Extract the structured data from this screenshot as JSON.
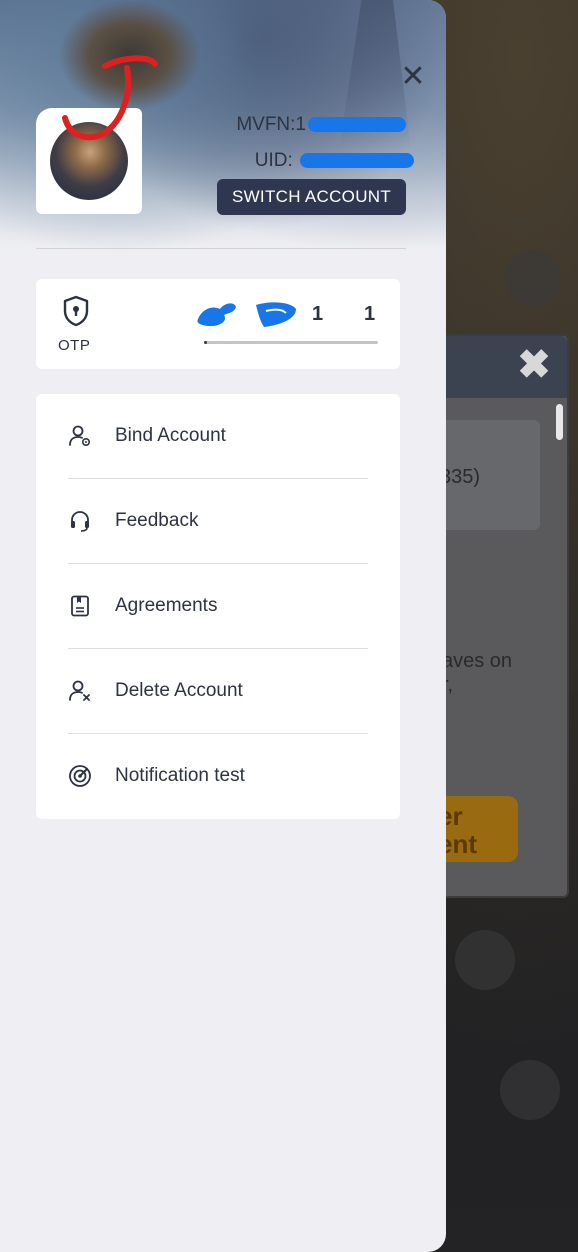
{
  "header": {
    "close_glyph": "✕",
    "mvfn_label": "MVFN:",
    "mvfn_visible_prefix": "1",
    "uid_label": "UID:",
    "switch_account_label": "SWITCH ACCOUNT"
  },
  "otp": {
    "label": "OTP",
    "count_a": "1",
    "count_b": "1",
    "progress": 0.01
  },
  "menu": {
    "items": [
      {
        "label": "Bind Account",
        "icon": "user-gear-icon"
      },
      {
        "label": "Feedback",
        "icon": "headset-icon"
      },
      {
        "label": "Agreements",
        "icon": "document-icon"
      },
      {
        "label": "Delete Account",
        "icon": "user-remove-icon"
      },
      {
        "label": "Notification test",
        "icon": "radar-icon"
      }
    ]
  },
  "background_game": {
    "close_glyph": "✖",
    "text_fragment_1": "335)",
    "text_fragment_2": "aves on",
    "text_fragment_3": "r,",
    "button_text_line1": "er",
    "button_text_line2": "ent"
  },
  "colors": {
    "drawer_bg": "#efeff3",
    "switch_button_bg": "#2f3650",
    "redaction_blue": "#1877e8",
    "scribble_red": "#e02020"
  }
}
